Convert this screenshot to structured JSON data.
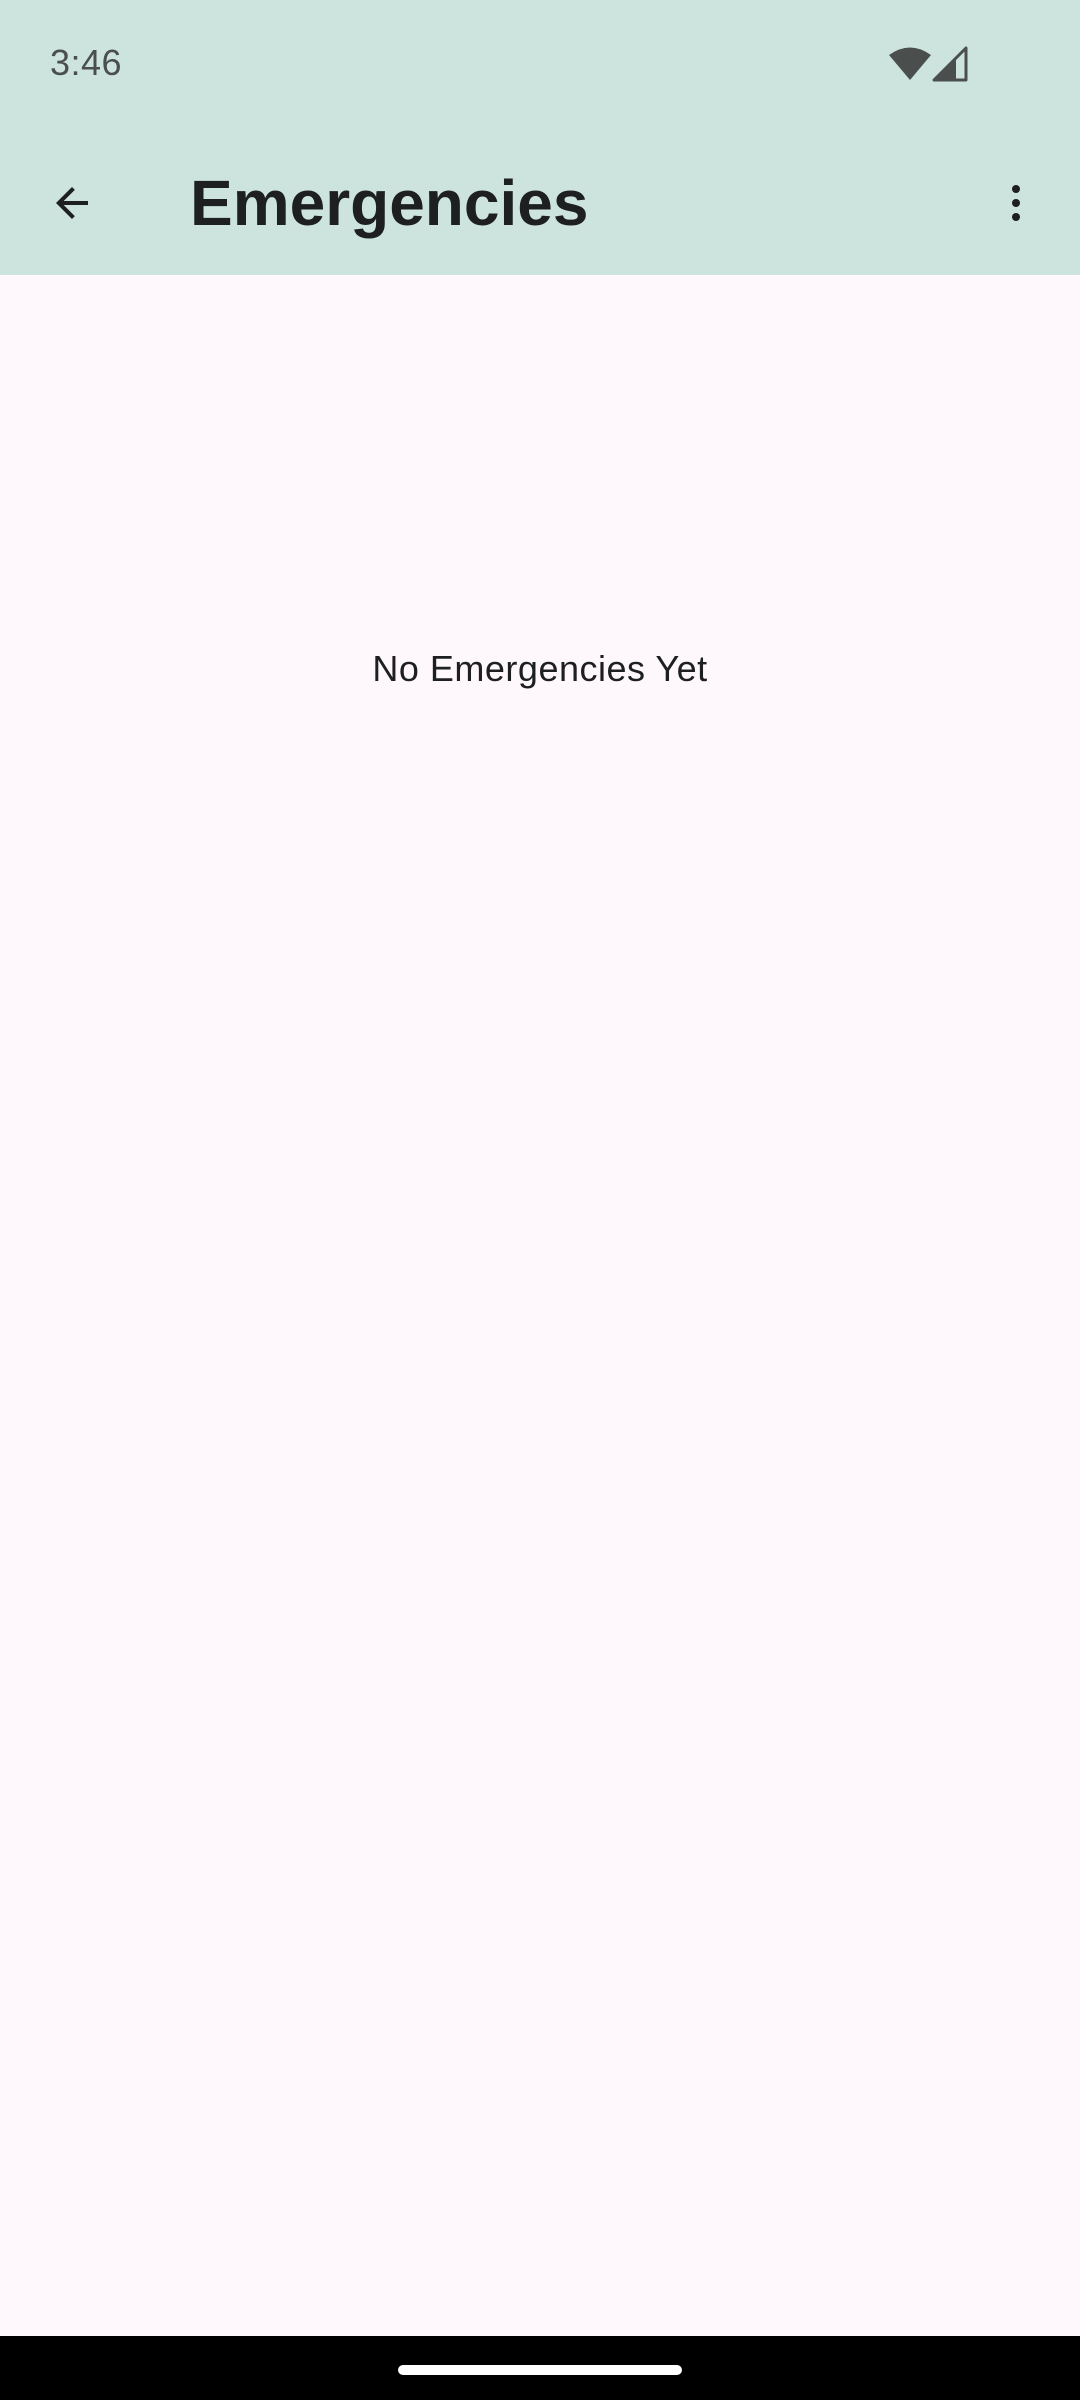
{
  "status_bar": {
    "time": "3:46",
    "icons": [
      "wifi-icon",
      "cellular-signal-icon"
    ]
  },
  "app_bar": {
    "title": "Emergencies",
    "back_icon": "arrow-back-icon",
    "menu_icon": "more-vert-icon"
  },
  "content": {
    "empty_message": "No Emergencies Yet"
  },
  "colors": {
    "app_bar_bg": "#cde4de",
    "page_bg": "#fef8fc",
    "text": "#1d1f20"
  }
}
